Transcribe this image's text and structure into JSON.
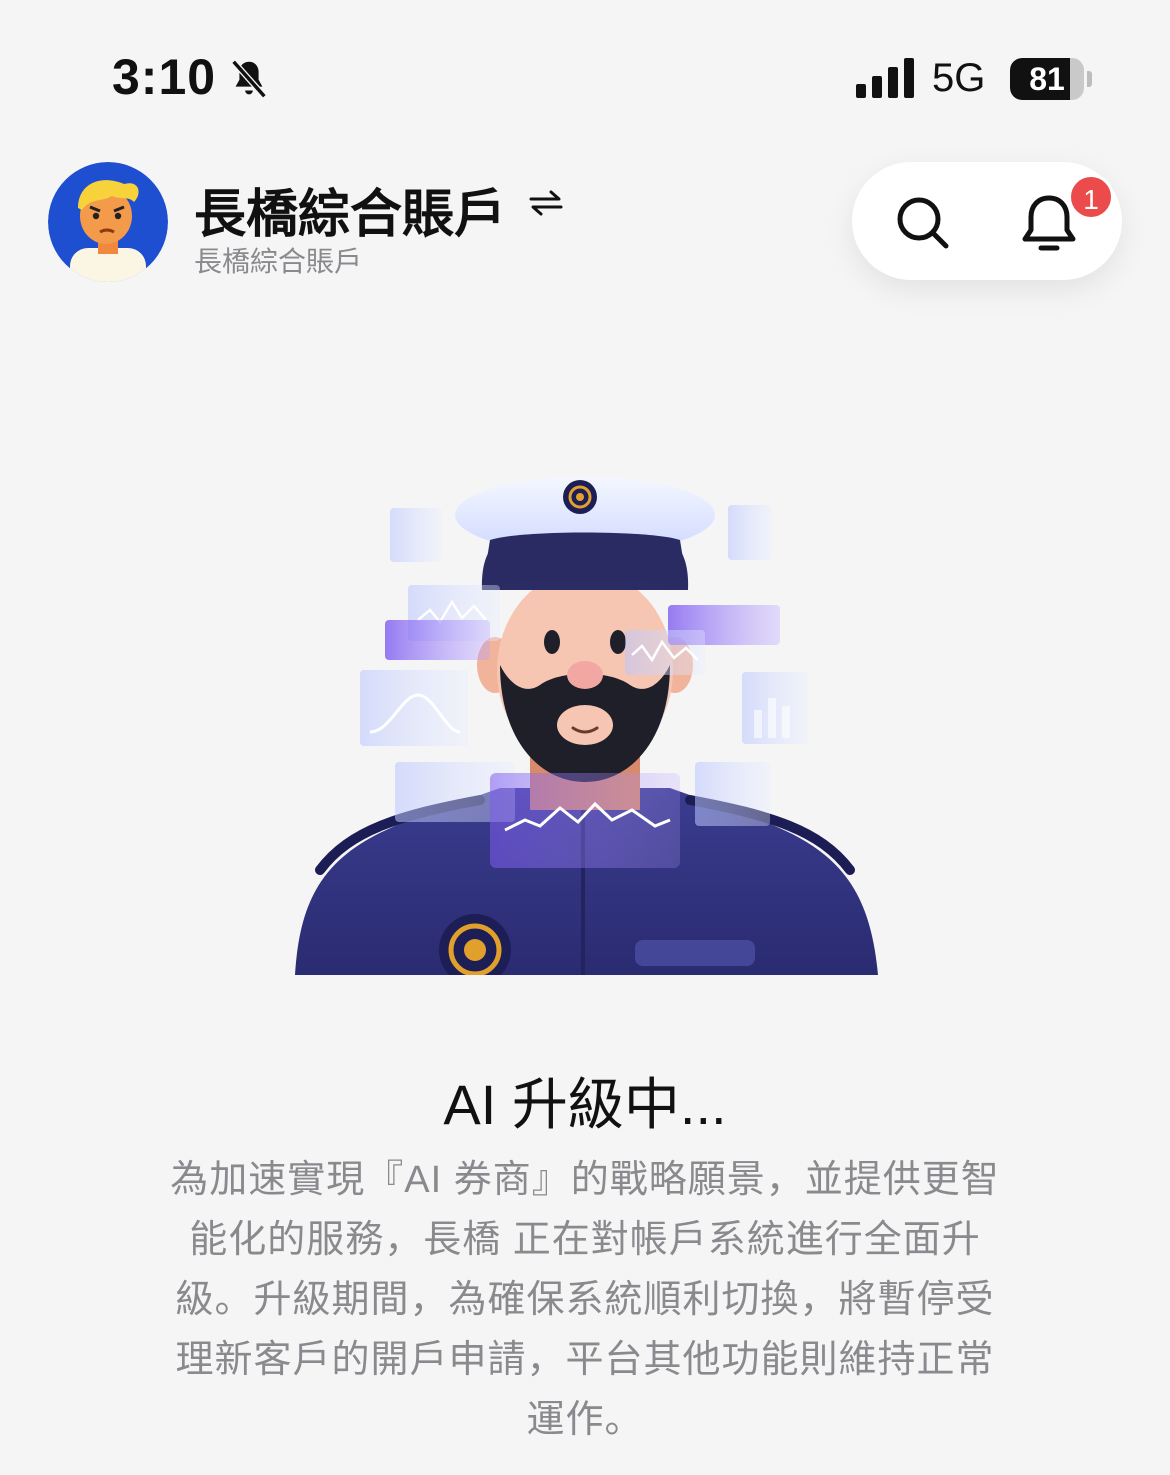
{
  "status_bar": {
    "time": "3:10",
    "silent_icon": "bell-slash-icon",
    "network": "5G",
    "battery_level": "81",
    "battery_fraction": 0.81
  },
  "header": {
    "account_name": "長橋綜合賬戶",
    "account_switch_icon": "swap-arrows-icon",
    "account_subtitle": "長橋綜合賬戶",
    "search_icon": "search-icon",
    "notification_icon": "bell-icon",
    "notification_count": "1"
  },
  "illustration": {
    "subject": "captain-avatar-illustration"
  },
  "notice": {
    "title": "AI 升級中...",
    "body": "為加速實現『AI 券商』的戰略願景，並提供更智能化的服務，長橋 正在對帳戶系統進行全面升級。升級期間，為確保系統順利切換，將暫停受理新客戶的開戶申請，平台其他功能則維持正常運作。"
  },
  "colors": {
    "background": "#f5f5f6",
    "badge": "#ec4b4b",
    "muted_text": "#8a8a8e",
    "avatar_bg": "#1f4fd1",
    "uniform": "#2d2f7a",
    "accent_purple": "#8a6cf0"
  }
}
